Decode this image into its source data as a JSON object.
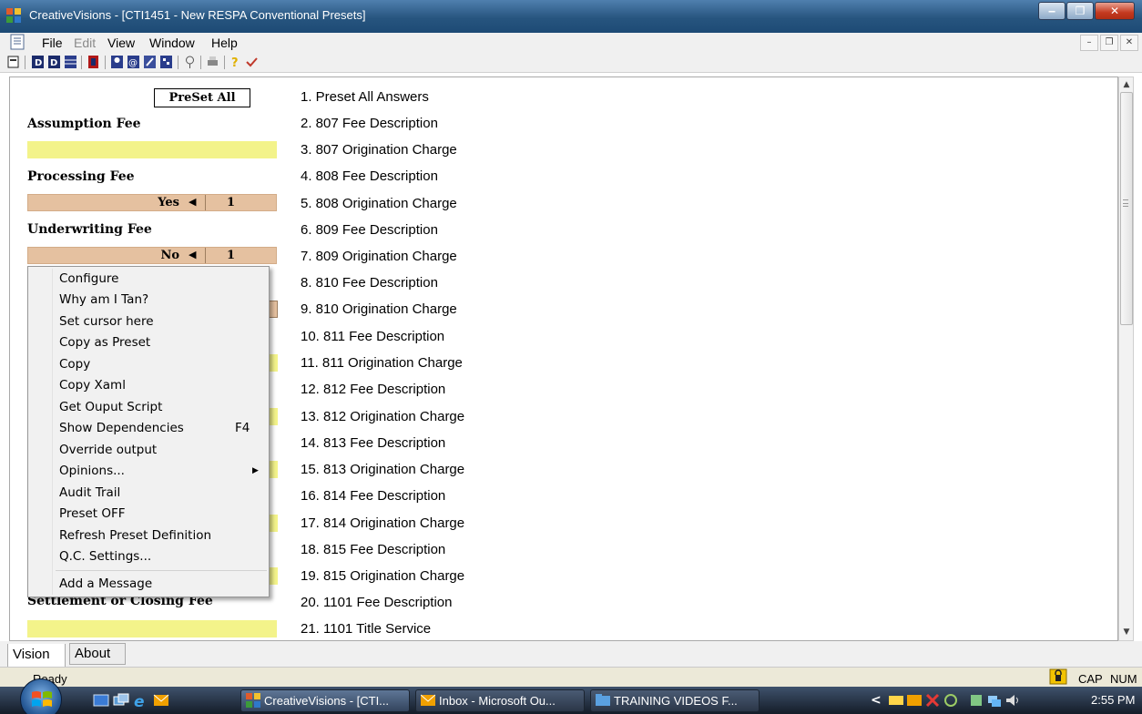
{
  "window": {
    "title": "CreativeVisions - [CTI1451 - New RESPA Conventional Presets]"
  },
  "menubar": {
    "items": [
      "File",
      "Edit",
      "View",
      "Window",
      "Help"
    ]
  },
  "toolbar": {
    "icons": [
      "document-icon",
      "bold-d-icon",
      "fd-icon",
      "spreadsheet-icon",
      "red-block-icon",
      "person-icon",
      "at-icon",
      "tools-icon",
      "grid-icon",
      "pin-icon",
      "print-icon",
      "help-icon",
      "checkmark-icon"
    ]
  },
  "left_panel": {
    "preset_all_label": "PreSet All",
    "fields": [
      {
        "label": "Assumption Fee"
      },
      {
        "label": "Processing Fee",
        "value": "Yes",
        "count": "1"
      },
      {
        "label": "Underwriting Fee",
        "value": "No",
        "count": "1"
      },
      {
        "label": "Settlement or Closing Fee"
      }
    ]
  },
  "questions": [
    "1. Preset All Answers",
    "2. 807 Fee Description",
    "3. 807 Origination Charge",
    "4. 808 Fee Description",
    "5. 808 Origination Charge",
    "6. 809 Fee Description",
    "7. 809 Origination Charge",
    "8. 810 Fee Description",
    "9. 810 Origination Charge",
    "10. 811 Fee Description",
    "11. 811 Origination Charge",
    "12. 812 Fee Description",
    "13. 812 Origination Charge",
    "14. 813 Fee Description",
    "15. 813 Origination Charge",
    "16. 814 Fee Description",
    "17. 814 Origination Charge",
    "18. 815 Fee Description",
    "19. 815 Origination Charge",
    "20. 1101 Fee Description",
    "21. 1101 Title Service"
  ],
  "context_menu": {
    "items": [
      "Configure",
      "Why am I Tan?",
      "Set cursor here",
      "Copy as Preset",
      "Copy",
      "Copy Xaml",
      "Get Ouput Script",
      "Show Dependencies",
      "Override output",
      "Opinions...",
      "Audit Trail",
      "Preset OFF",
      "Refresh Preset Definition",
      "Q.C. Settings...",
      "Add a Message"
    ],
    "shortcut": "F4"
  },
  "tabs": [
    "Vision",
    "About"
  ],
  "status": {
    "text": "Ready",
    "caps": "CAP",
    "num": "NUM"
  },
  "taskbar": {
    "tasks": [
      "CreativeVisions - [CTI...",
      "Inbox - Microsoft Ou...",
      "TRAINING VIDEOS F..."
    ],
    "clock": "2:55 PM"
  },
  "colors": {
    "title_bar": "#27557f",
    "yellow_field": "#f3f38a",
    "tan_field": "#e5c1a0",
    "taskbar": "#1e2a3a"
  }
}
